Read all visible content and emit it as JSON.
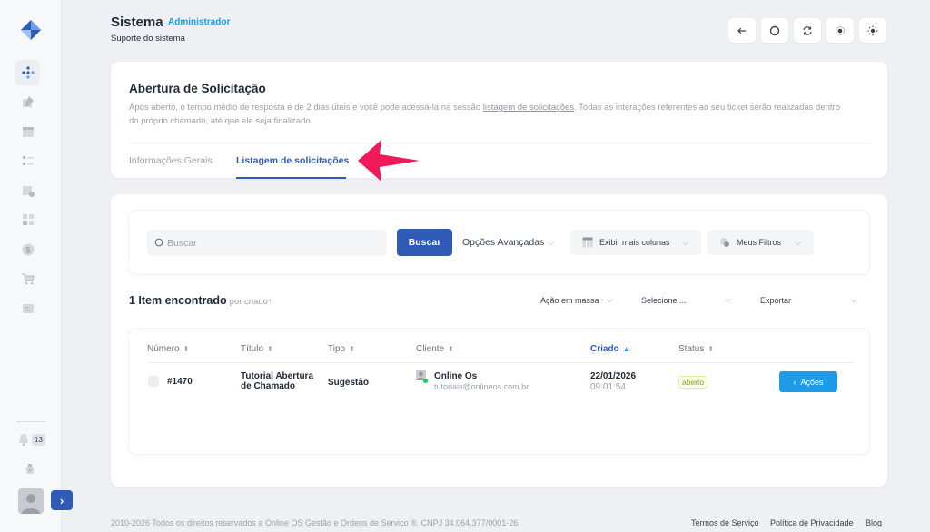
{
  "header": {
    "title": "Sistema",
    "role": "Administrador",
    "subtitle": "Suporte do sistema",
    "buttons": [
      "back-arrow-icon",
      "circle-icon",
      "refresh-icon",
      "target-icon",
      "sun-icon"
    ]
  },
  "sidebar": {
    "notification_count": "13",
    "items": [
      "dashboard-icon",
      "edit-icon",
      "calendar-icon",
      "checklist-icon",
      "schedule-icon",
      "modules-icon",
      "dollar-icon",
      "cart-icon",
      "id-card-icon"
    ]
  },
  "card": {
    "title": "Abertura de Solicitação",
    "desc_before": "Após aberto, o tempo médio de resposta é de 2 dias úteis e você pode acessá-la na sessão ",
    "desc_link": "listagem de solicitações",
    "desc_after": ". Todas as interações referentes ao seu ticket serão realizadas dentro do próprio chamado, até que ele seja finalizado.",
    "tabs": [
      {
        "label": "Informações Gerais",
        "active": false
      },
      {
        "label": "Listagem de solicitações",
        "active": true
      }
    ]
  },
  "search": {
    "placeholder": "Buscar",
    "button": "Buscar",
    "advanced": "Opções Avançadas",
    "columns": "Exibir mais colunas",
    "filters": "Meus Filtros"
  },
  "results": {
    "count_text": "1 Item encontrado",
    "sort_text": "por criado",
    "sort_icon": "↑",
    "mass_action": "Ação em massa",
    "select": "Selecione ...",
    "export": "Exportar"
  },
  "table": {
    "columns": [
      "Número",
      "Título",
      "Tipo",
      "Cliente",
      "Criado",
      "Status"
    ],
    "active_column": "Criado",
    "rows": [
      {
        "number": "#1470",
        "title": "Tutorial Abertura de Chamado",
        "type": "Sugestão",
        "client": "Online Os",
        "email": "tutoriais@onlineos.com.br",
        "date": "22/01/2026",
        "time": "09:01:54",
        "status": "aberto",
        "actions": "Ações"
      }
    ]
  },
  "footer": {
    "copyright": "2010-2026 Todos os direitos reservados a Online OS Gestão e Ordens de Serviço ®. CNPJ 34.064.377/0001-26",
    "links": [
      "Termos de Serviço",
      "Política de Privacidade",
      "Blog"
    ]
  },
  "colors": {
    "primary": "#2f5bb7",
    "accent": "#1e9be6",
    "arrow": "#f0195a",
    "status_green": "#84a522"
  }
}
